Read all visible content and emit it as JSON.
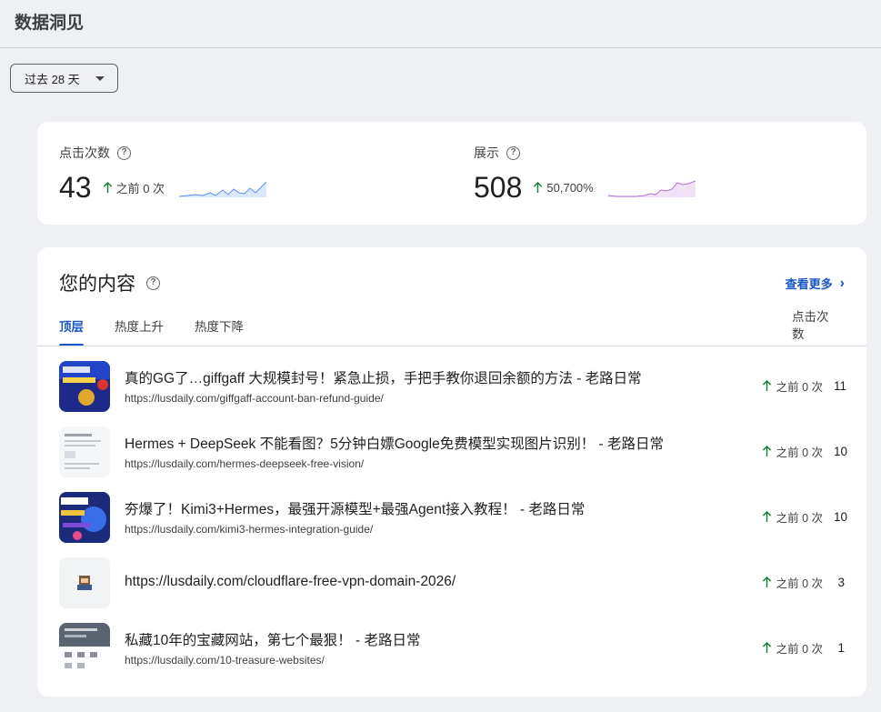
{
  "page": {
    "title": "数据洞见"
  },
  "date_filter": {
    "value": "过去 28 天"
  },
  "stats": {
    "clicks": {
      "label": "点击次数",
      "value": "43",
      "delta": "之前 0 次"
    },
    "impressions": {
      "label": "展示",
      "value": "508",
      "delta": "50,700%"
    }
  },
  "content": {
    "title": "您的内容",
    "more_label": "查看更多",
    "tabs": [
      "顶层",
      "热度上升",
      "热度下降"
    ],
    "column_header": "点击次数",
    "rows": [
      {
        "title": "真的GG了…giffgaff 大规模封号！紧急止损，手把手教你退回余额的方法 - 老路日常",
        "url": "https://lusdaily.com/giffgaff-account-ban-refund-guide/",
        "delta": "之前 0 次",
        "clicks": "11"
      },
      {
        "title": "Hermes + DeepSeek 不能看图？5分钟白嫖Google免费模型实现图片识别！ - 老路日常",
        "url": "https://lusdaily.com/hermes-deepseek-free-vision/",
        "delta": "之前 0 次",
        "clicks": "10"
      },
      {
        "title": "夯爆了！Kimi3+Hermes，最强开源模型+最强Agent接入教程！ - 老路日常",
        "url": "https://lusdaily.com/kimi3-hermes-integration-guide/",
        "delta": "之前 0 次",
        "clicks": "10"
      },
      {
        "title": "https://lusdaily.com/cloudflare-free-vpn-domain-2026/",
        "url": "",
        "delta": "之前 0 次",
        "clicks": "3"
      },
      {
        "title": "私藏10年的宝藏网站，第七个最狠！ - 老路日常",
        "url": "https://lusdaily.com/10-treasure-websites/",
        "delta": "之前 0 次",
        "clicks": "1"
      }
    ]
  },
  "colors": {
    "accent": "#1a56c7",
    "up": "#188038"
  }
}
